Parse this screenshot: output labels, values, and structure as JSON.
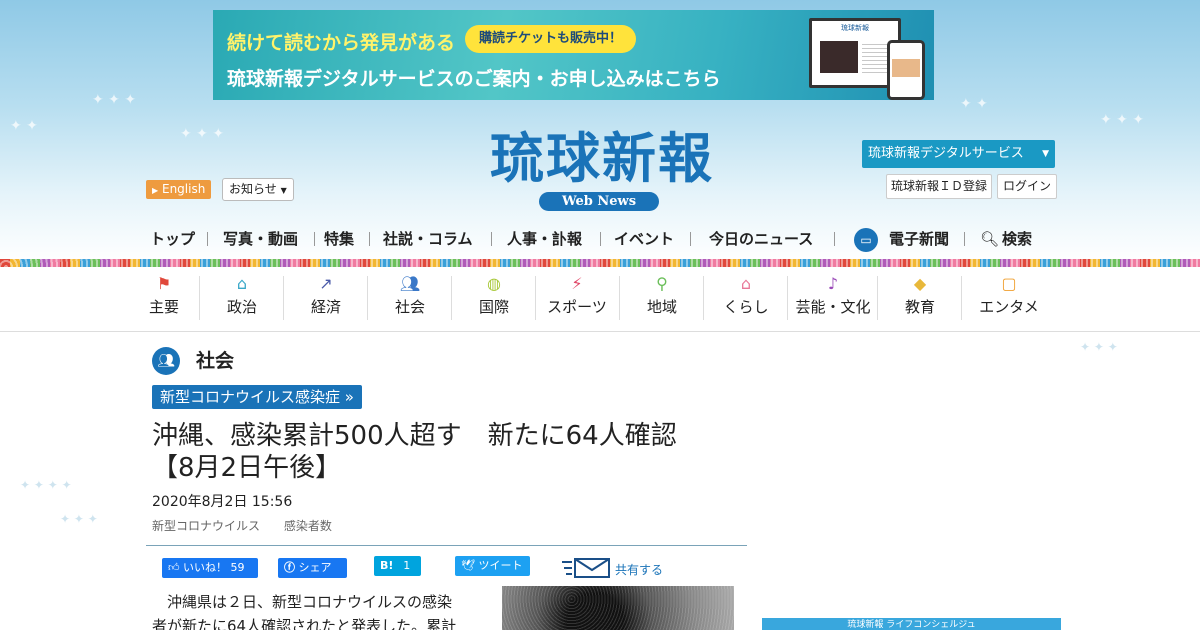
{
  "banner": {
    "line1": "続けて読むから発見がある",
    "pill": "購読チケットも販売中！",
    "line2": "琉球新報デジタルサービスのご案内・お申し込みはこちら",
    "screen_title": "琉球新報"
  },
  "logo": {
    "title": "琉球新報",
    "subtitle": "Web News"
  },
  "header": {
    "lang_label": "English",
    "notice_label": "お知らせ",
    "digital_service_label": "琉球新報デジタルサービス",
    "id_register_label": "琉球新報ＩＤ登録",
    "login_label": "ログイン"
  },
  "main_nav": {
    "items": [
      "トップ",
      "写真・動画",
      "特集",
      "社説・コラム",
      "人事・訃報",
      "イベント",
      "今日のニュース",
      "電子新聞",
      "検索"
    ]
  },
  "category_nav": {
    "items": [
      {
        "label": "主要",
        "icon": "flag-icon",
        "color": "#e0483b"
      },
      {
        "label": "政治",
        "icon": "parliament-icon",
        "color": "#3aa8c8"
      },
      {
        "label": "経済",
        "icon": "trend-icon",
        "color": "#4a5aa8"
      },
      {
        "label": "社会",
        "icon": "people-icon",
        "color": "#3a78c8"
      },
      {
        "label": "国際",
        "icon": "globe-icon",
        "color": "#a8c83a"
      },
      {
        "label": "スポーツ",
        "icon": "runner-icon",
        "color": "#e04868"
      },
      {
        "label": "地域",
        "icon": "pin-icon",
        "color": "#6bbf5a"
      },
      {
        "label": "くらし",
        "icon": "house-icon",
        "color": "#e87898"
      },
      {
        "label": "芸能・文化",
        "icon": "sanshin-icon",
        "color": "#9a4ab8"
      },
      {
        "label": "教育",
        "icon": "mortarboard-icon",
        "color": "#e8b83a"
      },
      {
        "label": "エンタメ",
        "icon": "tv-icon",
        "color": "#f0a030"
      }
    ]
  },
  "article": {
    "section": "社会",
    "topic_tag": "新型コロナウイルス感染症 »",
    "headline_line1": "沖縄、感染累計500人超す　新たに64人確認",
    "headline_line2": "【8月2日午後】",
    "date": "2020年8月2日 15:56",
    "tags": [
      "新型コロナウイルス",
      "感染者数"
    ],
    "body_line1": "沖縄県は２日、新型コロナウイルスの感染",
    "body_line2": "者が新たに64人確認されたと発表した。累計"
  },
  "share": {
    "fb_like": "いいね！",
    "fb_like_count": "59",
    "fb_share": "シェア",
    "hatena_label": "B!",
    "hatena_count": "1",
    "tweet": "ツイート",
    "share_text": "共有する"
  },
  "side": {
    "banner_text": "琉球新報 ライフコンシェルジュ"
  }
}
